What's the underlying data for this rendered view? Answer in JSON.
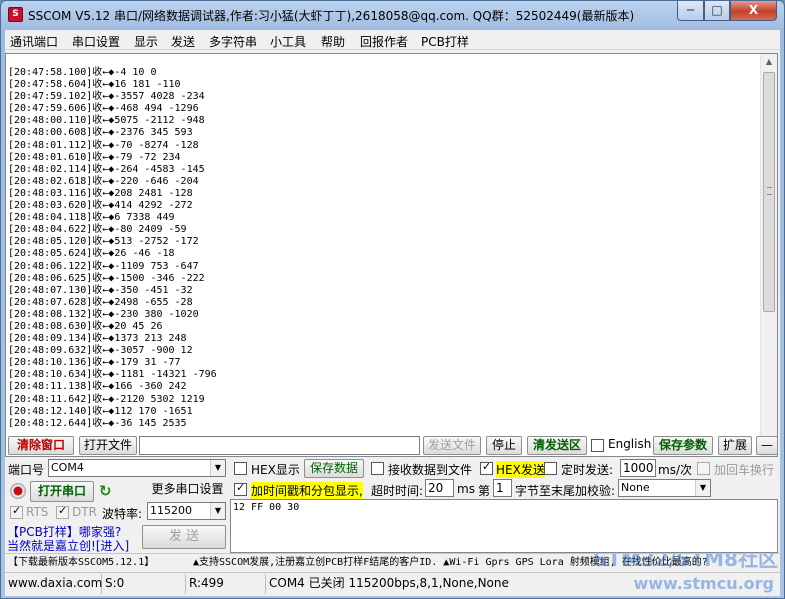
{
  "window": {
    "title": "SSCOM V5.12 串口/网络数据调试器,作者:习小猛(大虾丁丁),2618058@qq.com. QQ群：52502449(最新版本)",
    "icon_name": "app-icon",
    "minimize": "─",
    "maximize": "□",
    "close": "X"
  },
  "menu": [
    "通讯端口",
    "串口设置",
    "显示",
    "发送",
    "多字符串",
    "小工具",
    "帮助",
    "回报作者",
    "PCB打样"
  ],
  "receive_lines": [
    "[20:47:58.100]收←◆-4 10 0",
    "[20:47:58.604]收←◆16 181 -110",
    "[20:47:59.102]收←◆-3557 4028 -234",
    "[20:47:59.606]收←◆-468 494 -1296",
    "[20:48:00.110]收←◆5075 -2112 -948",
    "[20:48:00.608]收←◆-2376 345 593",
    "[20:48:01.112]收←◆-70 -8274 -128",
    "[20:48:01.610]收←◆-79 -72 234",
    "[20:48:02.114]收←◆-264 -4583 -145",
    "[20:48:02.618]收←◆-220 -646 -204",
    "[20:48:03.116]收←◆208 2481 -128",
    "[20:48:03.620]收←◆414 4292 -272",
    "[20:48:04.118]收←◆6 7338 449",
    "[20:48:04.622]收←◆-80 2409 -59",
    "[20:48:05.120]收←◆513 -2752 -172",
    "[20:48:05.624]收←◆26 -46 -18",
    "[20:48:06.122]收←◆-1109 753 -647",
    "[20:48:06.625]收←◆-1500 -346 -222",
    "[20:48:07.130]收←◆-350 -451 -32",
    "[20:48:07.628]收←◆2498 -655 -28",
    "[20:48:08.132]收←◆-230 380 -1020",
    "[20:48:08.630]收←◆20 45 26",
    "[20:48:09.134]收←◆1373 213 248",
    "[20:48:09.632]收←◆-3057 -900 12",
    "[20:48:10.136]收←◆-179 31 -77",
    "[20:48:10.634]收←◆-1181 -14321 -796",
    "[20:48:11.138]收←◆166 -360 242",
    "[20:48:11.642]收←◆-2120 5302 1219",
    "[20:48:12.140]收←◆112 170 -1651",
    "[20:48:12.644]收←◆-36 145 2535"
  ],
  "toolbar": {
    "clear_window": "清除窗口",
    "open_file": "打开文件",
    "file_path": "",
    "send_file": "发送文件",
    "stop": "停止",
    "clear_send": "清发送区",
    "english": "English",
    "save_params": "保存参数",
    "expand": "扩展",
    "collapse": "—"
  },
  "port": {
    "port_label": "端口号",
    "port_value": "COM4",
    "hex_display": "HEX显示",
    "save_data": "保存数据",
    "recv_to_file": "接收数据到文件",
    "hex_send": "HEX发送",
    "timed_send": "定时发送:",
    "interval_value": "1000",
    "interval_unit": "ms/次",
    "add_crlf": "加回车换行",
    "open_port": "打开串口",
    "more_settings": "更多串口设置",
    "add_timestamp": "加时间戳和分包显示,",
    "timeout_label": "超时时间:",
    "timeout_value": "20",
    "timeout_unit": "ms",
    "nth_label": "第",
    "nth_value": "1",
    "checksum_label": "字节至末尾加校验:",
    "checksum_value": "None",
    "rts": "RTS",
    "dtr": "DTR",
    "baud_label": "波特率:",
    "baud_value": "115200",
    "send_button": "发  送"
  },
  "send_data": "12 FF 00 30",
  "promo": {
    "line1_a": "【PCB打样】",
    "line1_b": "哪家强?",
    "line2_a": "当然就是嘉立创!",
    "line2_b": "[进入]"
  },
  "ticker": {
    "left": "【下载最新版本SSCOM5.12.1】",
    "right": "▲支持SSCOM发展,注册嘉立创PCB打样F结尾的客户ID. ▲Wi-Fi Gprs GPS Lora 射频模组, 在找性价比最高的?"
  },
  "watermark": {
    "line1": "STM32/STM8社区",
    "line2": "www.stmcu.org"
  },
  "status": {
    "website": "www.daxia.com",
    "sent": "S:0",
    "received": "R:499",
    "port_state": "COM4 已关闭  115200bps,8,1,None,None"
  }
}
